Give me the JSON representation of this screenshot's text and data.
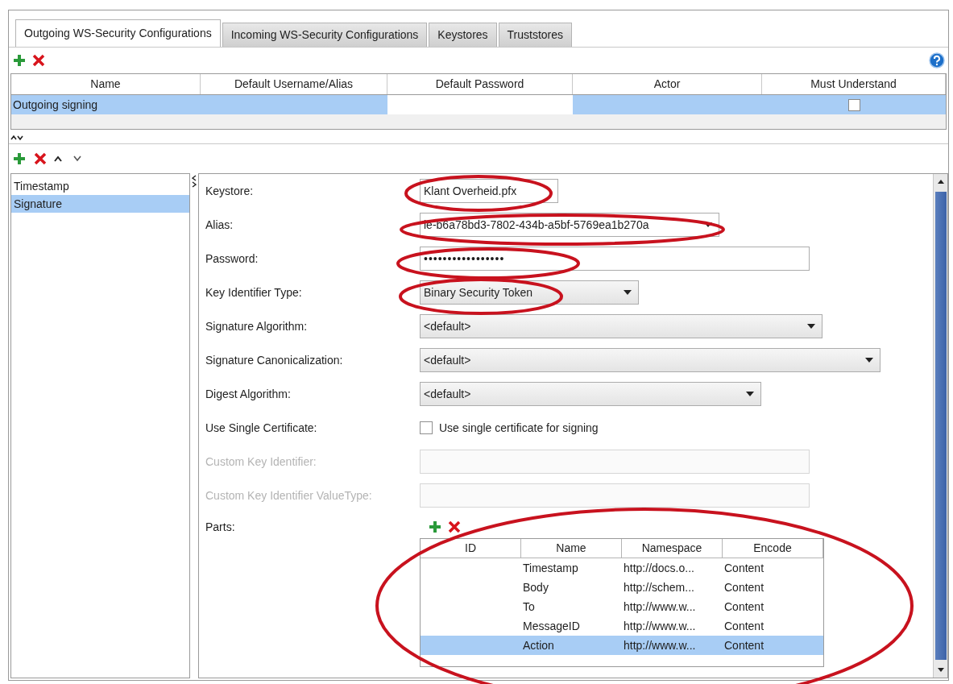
{
  "tabs": [
    {
      "label": "Outgoing WS-Security Configurations",
      "selected": true
    },
    {
      "label": "Incoming WS-Security Configurations",
      "selected": false
    },
    {
      "label": "Keystores",
      "selected": false
    },
    {
      "label": "Truststores",
      "selected": false
    }
  ],
  "configurations": {
    "columns": [
      "Name",
      "Default Username/Alias",
      "Default Password",
      "Actor",
      "Must Understand"
    ],
    "rows": [
      {
        "name": "Outgoing signing",
        "selected": true,
        "must_understand": false
      }
    ]
  },
  "entries": [
    {
      "label": "Timestamp",
      "selected": false
    },
    {
      "label": "Signature",
      "selected": true
    }
  ],
  "form": [
    {
      "label": "Keystore:",
      "kind": "combo",
      "value": "Klant Overheid.pfx",
      "disabled": false
    },
    {
      "label": "Alias:",
      "kind": "dropdown",
      "value": "le-b6a78bd3-7802-434b-a5bf-5769ea1b270a",
      "disabled": false
    },
    {
      "label": "Password:",
      "kind": "text",
      "value": "•••••••••••••••••",
      "disabled": false
    },
    {
      "label": "Key Identifier Type:",
      "kind": "dropdown",
      "value": "Binary Security Token",
      "disabled": false
    },
    {
      "label": "Signature Algorithm:",
      "kind": "dropdown",
      "value": "<default>",
      "disabled": false
    },
    {
      "label": "Signature Canonicalization:",
      "kind": "dropdown",
      "value": "<default>",
      "disabled": false
    },
    {
      "label": "Digest Algorithm:",
      "kind": "dropdown",
      "value": "<default>",
      "disabled": false
    },
    {
      "label": "Use Single Certificate:",
      "kind": "checkbox",
      "text": "Use single certificate for signing",
      "checked": false,
      "disabled": false
    },
    {
      "label": "Custom Key Identifier:",
      "kind": "text",
      "disabled": true
    },
    {
      "label": "Custom Key Identifier ValueType:",
      "kind": "text",
      "disabled": true
    }
  ],
  "parts": {
    "label": "Parts:",
    "columns": [
      "ID",
      "Name",
      "Namespace",
      "Encode"
    ],
    "rows": [
      {
        "name": "Timestamp",
        "namespace": "http://docs.o...",
        "encode": "Content",
        "selected": false
      },
      {
        "name": "Body",
        "namespace": "http://schem...",
        "encode": "Content",
        "selected": false
      },
      {
        "name": "To",
        "namespace": "http://www.w...",
        "encode": "Content",
        "selected": false
      },
      {
        "name": "MessageID",
        "namespace": "http://www.w...",
        "encode": "Content",
        "selected": false
      },
      {
        "name": "Action",
        "namespace": "http://www.w...",
        "encode": "Content",
        "selected": true
      }
    ]
  }
}
